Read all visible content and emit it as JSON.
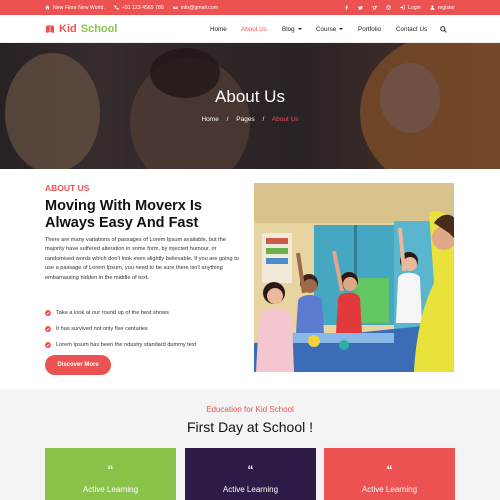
{
  "topbar": {
    "address": "New Floor New World.",
    "phone": "+91 123 4565 789",
    "email": "info@gmail.com",
    "social": [
      "facebook-icon",
      "twitter-icon",
      "vimeo-icon",
      "instagram-icon"
    ],
    "login": "Login",
    "register": "register"
  },
  "brand": {
    "kid": "Kid",
    "school": "School"
  },
  "nav": {
    "items": [
      {
        "label": "Home"
      },
      {
        "label": "About Us"
      },
      {
        "label": "Blog"
      },
      {
        "label": "Course"
      },
      {
        "label": "Portfolio"
      },
      {
        "label": "Contact Us"
      }
    ]
  },
  "hero": {
    "title": "About Us",
    "crumbs": {
      "home": "Home",
      "sep": "/",
      "pages": "Pages",
      "current": "About Us"
    }
  },
  "about": {
    "kicker": "ABOUT US",
    "title": "Moving With Moverx Is Always Easy And Fast",
    "text": "There are many variations of passages of Lorem Ipsum available, but the majority have suffered alteration in some form, by injected humour, or randomised words which don't look even slightly believable. If you are going to use a passage of Lorem Ipsum, you need to be sure there isn't anything embarrassing hidden in the middle of text.",
    "checks": [
      "Take a look at our round up of the best shows",
      "It has survived not only five centuries",
      "Lorem Ipsum has been the ndustry standard dummy text"
    ],
    "button": "Discover More"
  },
  "education": {
    "kicker": "Education for Kid School",
    "title": "First Day at School !",
    "cards": [
      {
        "quote": "“",
        "label": "Active Learning"
      },
      {
        "quote": "“",
        "label": "Active Learning"
      },
      {
        "quote": "“",
        "label": "Active Learning"
      }
    ]
  },
  "colors": {
    "accent": "#ec5252",
    "green": "#8bc34a",
    "purple": "#2b1b46"
  }
}
